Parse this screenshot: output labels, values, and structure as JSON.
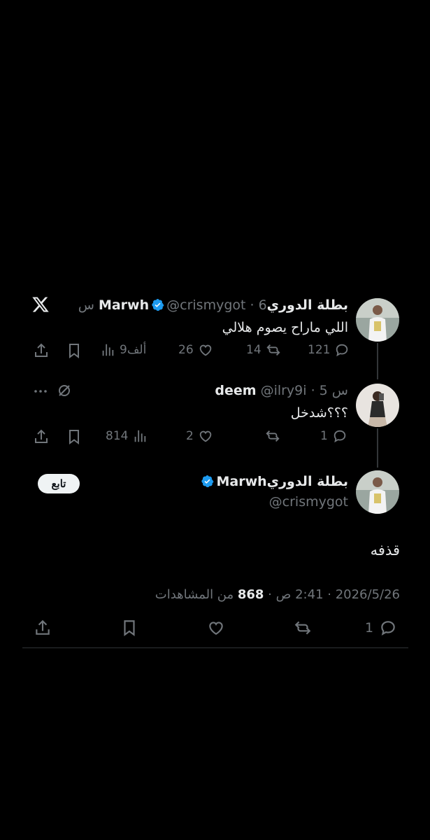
{
  "tweet1": {
    "display_name": "بطلة الدوريMarwh",
    "handle_time": "@crismygot · 6 س",
    "text": "اللي ماراح يصوم هلالي",
    "views": "9ألف",
    "likes": "26",
    "retweets": "14",
    "replies": "121"
  },
  "tweet2": {
    "display_name": "deem",
    "handle_time": "@ilry9i · 5 س",
    "text": "؟؟؟شدخل",
    "views": "814",
    "likes": "2",
    "retweets": "",
    "replies": "1"
  },
  "main": {
    "display_name": "بطلة الدوريMarwh",
    "handle": "@crismygot",
    "follow_label": "تابع",
    "text": "قذفه",
    "meta_date": "2026/5/26 · 2:41 ص · ",
    "meta_views": "868",
    "meta_views_label": " من المشاهدات",
    "replies": "1"
  },
  "icons": {
    "app": "x-logo-icon",
    "verified_color": "#1d9bf0"
  }
}
